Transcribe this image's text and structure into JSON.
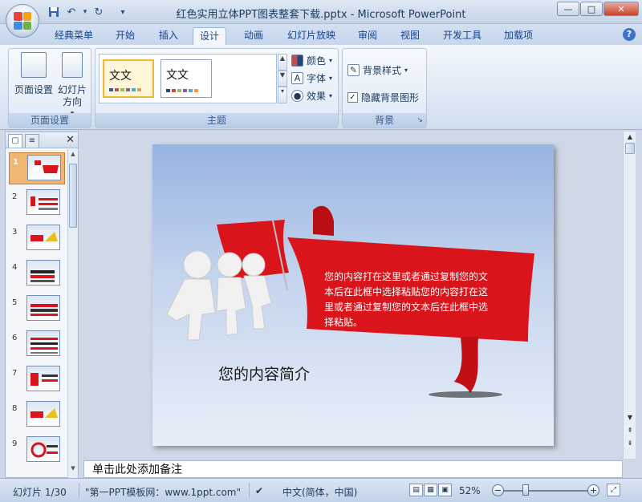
{
  "window": {
    "title": "红色实用立体PPT图表整套下载.pptx - Microsoft PowerPoint",
    "controls": {
      "minimize": "—",
      "maximize": "□",
      "close": "✕"
    }
  },
  "qat": {
    "save_icon": "save-icon",
    "undo_icon": "undo-icon",
    "redo_icon": "redo-icon",
    "customize": "▾"
  },
  "tabs": [
    {
      "label": "经典菜单"
    },
    {
      "label": "开始"
    },
    {
      "label": "插入"
    },
    {
      "label": "设计",
      "active": true
    },
    {
      "label": "动画"
    },
    {
      "label": "幻灯片放映"
    },
    {
      "label": "审阅"
    },
    {
      "label": "视图"
    },
    {
      "label": "开发工具"
    },
    {
      "label": "加载项"
    }
  ],
  "ribbon": {
    "page_setup": {
      "group_label": "页面设置",
      "page_setup_btn": "页面设置",
      "orientation_btn": "幻灯片方向"
    },
    "themes": {
      "group_label": "主题",
      "theme1": "文文",
      "theme2": "文文",
      "colors": "颜色",
      "fonts": "字体",
      "effects": "效果"
    },
    "background": {
      "group_label": "背景",
      "styles": "背景样式",
      "hide_graphics": "隐藏背景图形",
      "hide_checked": "✓"
    }
  },
  "panel": {
    "close": "✕",
    "slides": [
      {
        "num": "1",
        "selected": true
      },
      {
        "num": "2"
      },
      {
        "num": "3"
      },
      {
        "num": "4"
      },
      {
        "num": "5"
      },
      {
        "num": "6"
      },
      {
        "num": "7"
      },
      {
        "num": "8"
      },
      {
        "num": "9"
      }
    ]
  },
  "slide": {
    "ribbon_text": "您的内容打在这里或者通过复制您的文本后在此框中选择粘贴您的内容打在这里或者通过复制您的文本后在此框中选择粘贴。",
    "intro": "您的内容简介"
  },
  "notes": {
    "placeholder": "单击此处添加备注"
  },
  "status": {
    "slide_counter": "幻灯片 1/30",
    "theme_name": "\"第一PPT模板网：www.1ppt.com\"",
    "language": "中文(简体，中国)",
    "zoom": "52%",
    "zoom_minus": "−",
    "zoom_plus": "+"
  },
  "colors": {
    "accent_red": "#d9141b",
    "ribbon_bg": "#dbe6f4",
    "selected_thumb": "#f0b572"
  }
}
